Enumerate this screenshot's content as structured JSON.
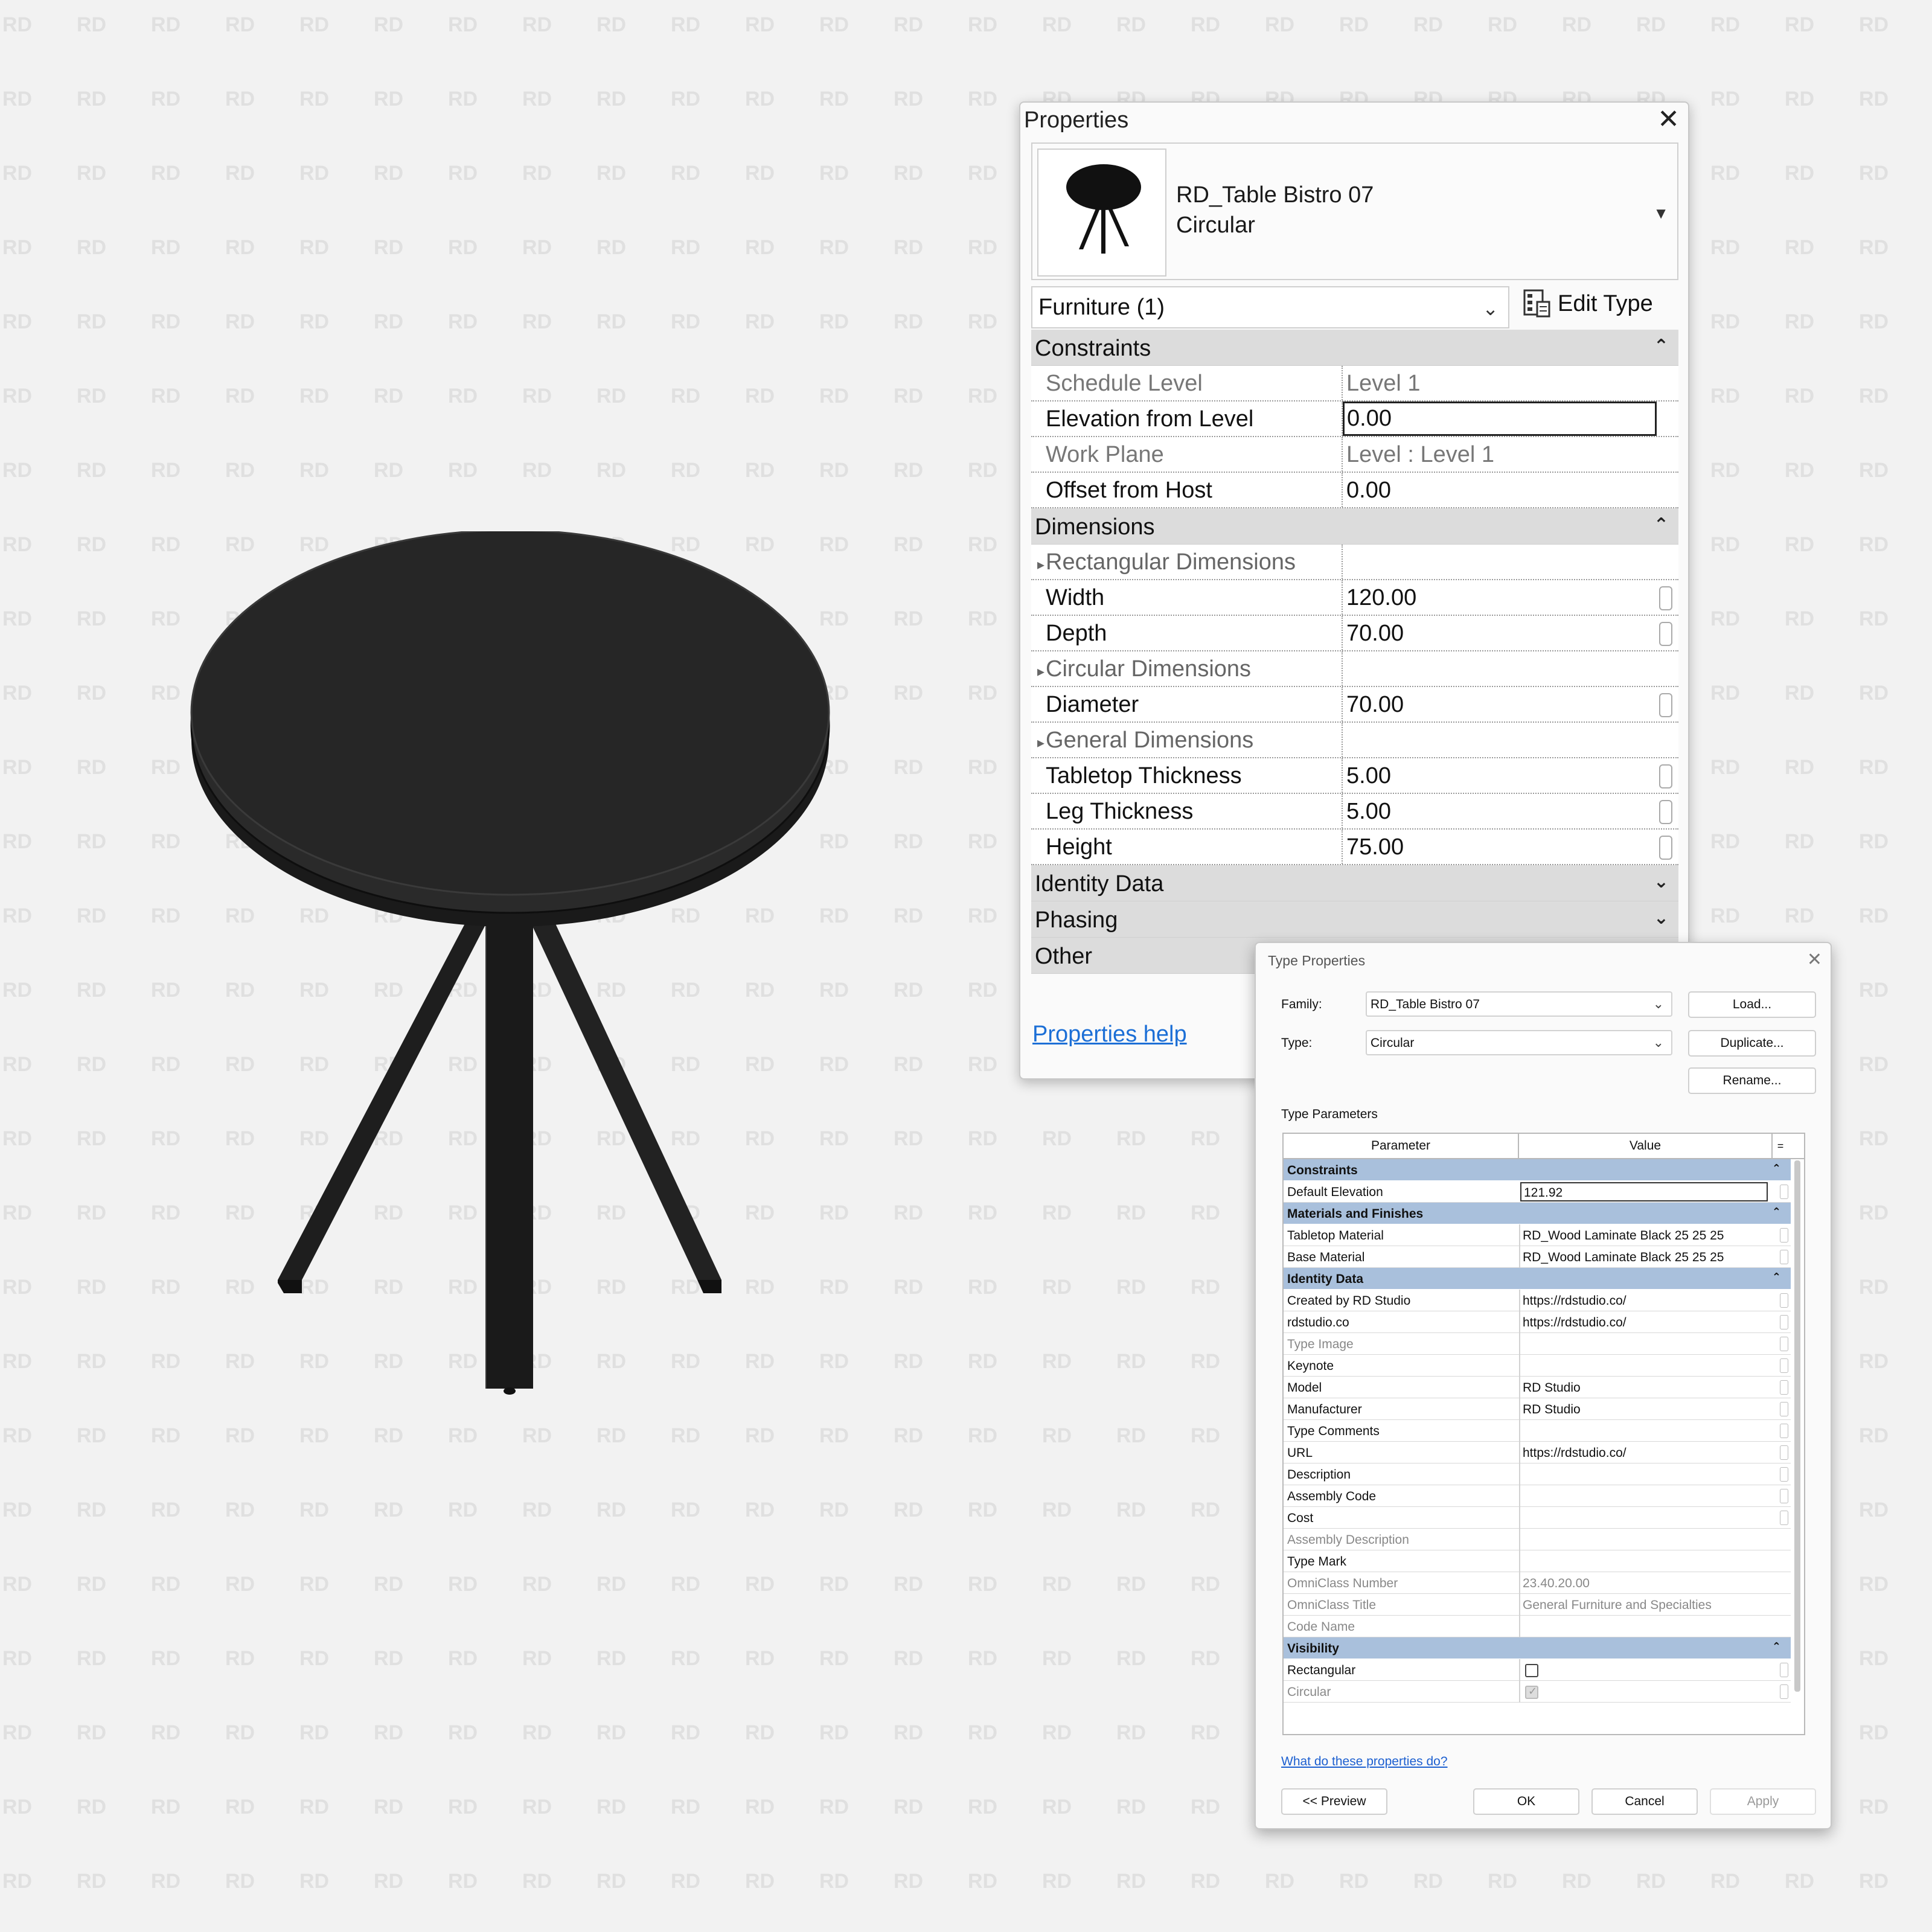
{
  "colors": {
    "background": "#f2f2f2",
    "watermark": "#e0e0e0",
    "table_body": "#262626",
    "section_blue": "#a9c0dc",
    "link": "#1c6fd6"
  },
  "watermark": {
    "text": "RD"
  },
  "properties": {
    "title": "Properties",
    "type_selector": {
      "family": "RD_Table Bistro 07",
      "type": "Circular"
    },
    "filter": "Furniture (1)",
    "edit_type_label": "Edit Type",
    "sections": {
      "constraints": "Constraints",
      "dimensions": "Dimensions",
      "identity_data": "Identity Data",
      "phasing": "Phasing",
      "other": "Other"
    },
    "constraints": {
      "schedule_level": {
        "name": "Schedule Level",
        "value": "Level 1"
      },
      "elevation_from_level": {
        "name": "Elevation from Level",
        "value": "0.00"
      },
      "work_plane": {
        "name": "Work Plane",
        "value": "Level : Level 1"
      },
      "offset_from_host": {
        "name": "Offset from Host",
        "value": "0.00"
      }
    },
    "dimensions": {
      "rectangular_group": "Rectangular Dimensions",
      "width": {
        "name": "Width",
        "value": "120.00"
      },
      "depth": {
        "name": "Depth",
        "value": "70.00"
      },
      "circular_group": "Circular Dimensions",
      "diameter": {
        "name": "Diameter",
        "value": "70.00"
      },
      "general_group": "General Dimensions",
      "tabletop_thickness": {
        "name": "Tabletop Thickness",
        "value": "5.00"
      },
      "leg_thickness": {
        "name": "Leg Thickness",
        "value": "5.00"
      },
      "height": {
        "name": "Height",
        "value": "75.00"
      }
    },
    "help_link": "Properties help"
  },
  "type_properties": {
    "title": "Type Properties",
    "family_label": "Family:",
    "family_value": "RD_Table Bistro 07",
    "type_label": "Type:",
    "type_value": "Circular",
    "buttons": {
      "load": "Load...",
      "duplicate": "Duplicate...",
      "rename": "Rename..."
    },
    "params_label": "Type Parameters",
    "headers": {
      "parameter": "Parameter",
      "value": "Value",
      "assoc": "="
    },
    "sections": {
      "constraints": "Constraints",
      "materials": "Materials and Finishes",
      "identity": "Identity Data",
      "visibility": "Visibility"
    },
    "rows": {
      "default_elevation": {
        "name": "Default Elevation",
        "value": "121.92"
      },
      "tabletop_material": {
        "name": "Tabletop Material",
        "value": "RD_Wood Laminate Black 25 25 25"
      },
      "base_material": {
        "name": "Base Material",
        "value": "RD_Wood Laminate Black 25 25 25"
      },
      "created_by": {
        "name": "Created by RD Studio",
        "value": "https://rdstudio.co/"
      },
      "rdstudio": {
        "name": "rdstudio.co",
        "value": "https://rdstudio.co/"
      },
      "type_image": {
        "name": "Type Image",
        "value": ""
      },
      "keynote": {
        "name": "Keynote",
        "value": ""
      },
      "model": {
        "name": "Model",
        "value": "RD Studio"
      },
      "manufacturer": {
        "name": "Manufacturer",
        "value": "RD Studio"
      },
      "type_comments": {
        "name": "Type Comments",
        "value": ""
      },
      "url": {
        "name": "URL",
        "value": "https://rdstudio.co/"
      },
      "description": {
        "name": "Description",
        "value": ""
      },
      "assembly_code": {
        "name": "Assembly Code",
        "value": ""
      },
      "cost": {
        "name": "Cost",
        "value": ""
      },
      "assembly_description": {
        "name": "Assembly Description",
        "value": ""
      },
      "type_mark": {
        "name": "Type Mark",
        "value": ""
      },
      "omniclass_number": {
        "name": "OmniClass Number",
        "value": "23.40.20.00"
      },
      "omniclass_title": {
        "name": "OmniClass Title",
        "value": "General Furniture and Specialties"
      },
      "code_name": {
        "name": "Code Name",
        "value": ""
      },
      "rectangular": {
        "name": "Rectangular",
        "checked": false
      },
      "circular": {
        "name": "Circular",
        "checked": true
      }
    },
    "help_link": "What do these properties do?",
    "footer": {
      "preview": "<< Preview",
      "ok": "OK",
      "cancel": "Cancel",
      "apply": "Apply"
    }
  }
}
